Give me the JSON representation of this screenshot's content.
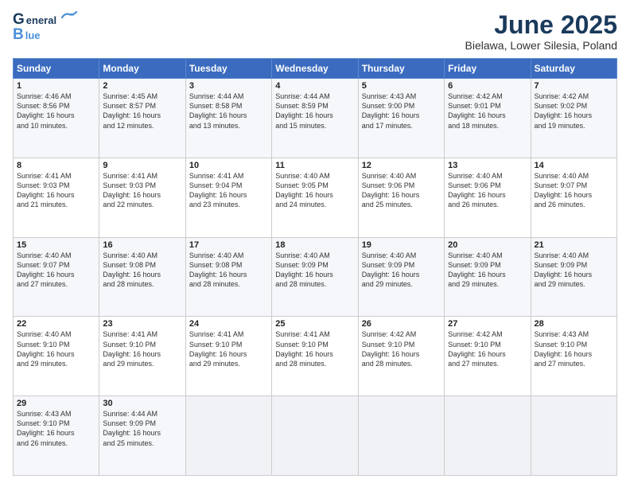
{
  "header": {
    "logo_general": "General",
    "logo_blue": "Blue",
    "title": "June 2025",
    "subtitle": "Bielawa, Lower Silesia, Poland"
  },
  "columns": [
    "Sunday",
    "Monday",
    "Tuesday",
    "Wednesday",
    "Thursday",
    "Friday",
    "Saturday"
  ],
  "weeks": [
    [
      {
        "day": "1",
        "lines": [
          "Sunrise: 4:46 AM",
          "Sunset: 8:56 PM",
          "Daylight: 16 hours",
          "and 10 minutes."
        ]
      },
      {
        "day": "2",
        "lines": [
          "Sunrise: 4:45 AM",
          "Sunset: 8:57 PM",
          "Daylight: 16 hours",
          "and 12 minutes."
        ]
      },
      {
        "day": "3",
        "lines": [
          "Sunrise: 4:44 AM",
          "Sunset: 8:58 PM",
          "Daylight: 16 hours",
          "and 13 minutes."
        ]
      },
      {
        "day": "4",
        "lines": [
          "Sunrise: 4:44 AM",
          "Sunset: 8:59 PM",
          "Daylight: 16 hours",
          "and 15 minutes."
        ]
      },
      {
        "day": "5",
        "lines": [
          "Sunrise: 4:43 AM",
          "Sunset: 9:00 PM",
          "Daylight: 16 hours",
          "and 17 minutes."
        ]
      },
      {
        "day": "6",
        "lines": [
          "Sunrise: 4:42 AM",
          "Sunset: 9:01 PM",
          "Daylight: 16 hours",
          "and 18 minutes."
        ]
      },
      {
        "day": "7",
        "lines": [
          "Sunrise: 4:42 AM",
          "Sunset: 9:02 PM",
          "Daylight: 16 hours",
          "and 19 minutes."
        ]
      }
    ],
    [
      {
        "day": "8",
        "lines": [
          "Sunrise: 4:41 AM",
          "Sunset: 9:03 PM",
          "Daylight: 16 hours",
          "and 21 minutes."
        ]
      },
      {
        "day": "9",
        "lines": [
          "Sunrise: 4:41 AM",
          "Sunset: 9:03 PM",
          "Daylight: 16 hours",
          "and 22 minutes."
        ]
      },
      {
        "day": "10",
        "lines": [
          "Sunrise: 4:41 AM",
          "Sunset: 9:04 PM",
          "Daylight: 16 hours",
          "and 23 minutes."
        ]
      },
      {
        "day": "11",
        "lines": [
          "Sunrise: 4:40 AM",
          "Sunset: 9:05 PM",
          "Daylight: 16 hours",
          "and 24 minutes."
        ]
      },
      {
        "day": "12",
        "lines": [
          "Sunrise: 4:40 AM",
          "Sunset: 9:06 PM",
          "Daylight: 16 hours",
          "and 25 minutes."
        ]
      },
      {
        "day": "13",
        "lines": [
          "Sunrise: 4:40 AM",
          "Sunset: 9:06 PM",
          "Daylight: 16 hours",
          "and 26 minutes."
        ]
      },
      {
        "day": "14",
        "lines": [
          "Sunrise: 4:40 AM",
          "Sunset: 9:07 PM",
          "Daylight: 16 hours",
          "and 26 minutes."
        ]
      }
    ],
    [
      {
        "day": "15",
        "lines": [
          "Sunrise: 4:40 AM",
          "Sunset: 9:07 PM",
          "Daylight: 16 hours",
          "and 27 minutes."
        ]
      },
      {
        "day": "16",
        "lines": [
          "Sunrise: 4:40 AM",
          "Sunset: 9:08 PM",
          "Daylight: 16 hours",
          "and 28 minutes."
        ]
      },
      {
        "day": "17",
        "lines": [
          "Sunrise: 4:40 AM",
          "Sunset: 9:08 PM",
          "Daylight: 16 hours",
          "and 28 minutes."
        ]
      },
      {
        "day": "18",
        "lines": [
          "Sunrise: 4:40 AM",
          "Sunset: 9:09 PM",
          "Daylight: 16 hours",
          "and 28 minutes."
        ]
      },
      {
        "day": "19",
        "lines": [
          "Sunrise: 4:40 AM",
          "Sunset: 9:09 PM",
          "Daylight: 16 hours",
          "and 29 minutes."
        ]
      },
      {
        "day": "20",
        "lines": [
          "Sunrise: 4:40 AM",
          "Sunset: 9:09 PM",
          "Daylight: 16 hours",
          "and 29 minutes."
        ]
      },
      {
        "day": "21",
        "lines": [
          "Sunrise: 4:40 AM",
          "Sunset: 9:09 PM",
          "Daylight: 16 hours",
          "and 29 minutes."
        ]
      }
    ],
    [
      {
        "day": "22",
        "lines": [
          "Sunrise: 4:40 AM",
          "Sunset: 9:10 PM",
          "Daylight: 16 hours",
          "and 29 minutes."
        ]
      },
      {
        "day": "23",
        "lines": [
          "Sunrise: 4:41 AM",
          "Sunset: 9:10 PM",
          "Daylight: 16 hours",
          "and 29 minutes."
        ]
      },
      {
        "day": "24",
        "lines": [
          "Sunrise: 4:41 AM",
          "Sunset: 9:10 PM",
          "Daylight: 16 hours",
          "and 29 minutes."
        ]
      },
      {
        "day": "25",
        "lines": [
          "Sunrise: 4:41 AM",
          "Sunset: 9:10 PM",
          "Daylight: 16 hours",
          "and 28 minutes."
        ]
      },
      {
        "day": "26",
        "lines": [
          "Sunrise: 4:42 AM",
          "Sunset: 9:10 PM",
          "Daylight: 16 hours",
          "and 28 minutes."
        ]
      },
      {
        "day": "27",
        "lines": [
          "Sunrise: 4:42 AM",
          "Sunset: 9:10 PM",
          "Daylight: 16 hours",
          "and 27 minutes."
        ]
      },
      {
        "day": "28",
        "lines": [
          "Sunrise: 4:43 AM",
          "Sunset: 9:10 PM",
          "Daylight: 16 hours",
          "and 27 minutes."
        ]
      }
    ],
    [
      {
        "day": "29",
        "lines": [
          "Sunrise: 4:43 AM",
          "Sunset: 9:10 PM",
          "Daylight: 16 hours",
          "and 26 minutes."
        ]
      },
      {
        "day": "30",
        "lines": [
          "Sunrise: 4:44 AM",
          "Sunset: 9:09 PM",
          "Daylight: 16 hours",
          "and 25 minutes."
        ]
      },
      {
        "day": "",
        "lines": []
      },
      {
        "day": "",
        "lines": []
      },
      {
        "day": "",
        "lines": []
      },
      {
        "day": "",
        "lines": []
      },
      {
        "day": "",
        "lines": []
      }
    ]
  ]
}
